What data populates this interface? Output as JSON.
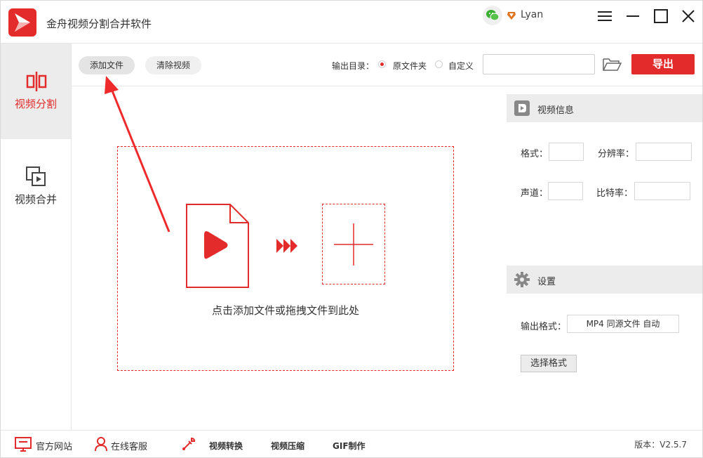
{
  "app": {
    "title": "金舟视频分割合并软件",
    "accent": "#e32b2b"
  },
  "user": {
    "name": "Lyan"
  },
  "window_controls": [
    "menu-icon",
    "minimize-icon",
    "maximize-icon",
    "close-icon"
  ],
  "sidebar": {
    "items": [
      {
        "label": "视频分割",
        "icon": "split-icon",
        "active": true
      },
      {
        "label": "视频合并",
        "icon": "merge-icon",
        "active": false
      }
    ]
  },
  "toolbar": {
    "add_file": "添加文件",
    "clear_video": "清除视频",
    "output_dir_label": "输出目录：",
    "radio_source": "原文件夹",
    "radio_custom": "自定义",
    "selected_radio": "原文件夹",
    "path_value": "",
    "export": "导出"
  },
  "dropzone": {
    "hint": "点击添加文件或拖拽文件到此处"
  },
  "video_info": {
    "title": "视频信息",
    "format_label": "格式：",
    "resolution_label": "分辨率：",
    "channel_label": "声道：",
    "bitrate_label": "比特率：",
    "format_value": "",
    "resolution_value": "",
    "channel_value": "",
    "bitrate_value": ""
  },
  "settings": {
    "title": "设置",
    "output_format_label": "输出格式：",
    "output_format_value": "MP4 同源文件 自动",
    "choose_format": "选择格式"
  },
  "footer": {
    "website": "官方网站",
    "support": "在线客服",
    "convert": "视频转换",
    "compress": "视频压缩",
    "gif": "GIF制作",
    "version": "版本：V2.5.7"
  }
}
